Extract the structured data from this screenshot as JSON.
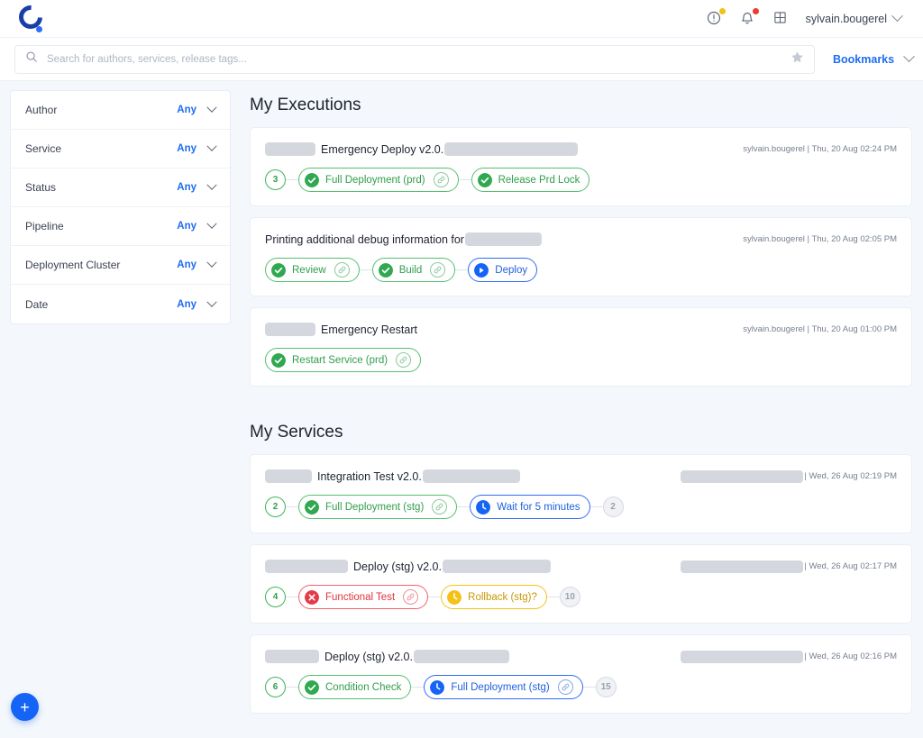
{
  "header": {
    "logo_name": "corp-logo",
    "icons": [
      {
        "name": "info-alert-icon",
        "dot": "yellow"
      },
      {
        "name": "notifications-bell-icon",
        "dot": "red"
      },
      {
        "name": "apps-grid-icon",
        "dot": "none"
      }
    ],
    "user": "sylvain.bougerel"
  },
  "search": {
    "placeholder": "Search for authors, services, release tags...",
    "value": "",
    "star_icon": "favorite-star-icon",
    "bookmarks_label": "Bookmarks"
  },
  "sidebar": {
    "filters": [
      {
        "name": "Author",
        "value": "Any"
      },
      {
        "name": "Service",
        "value": "Any"
      },
      {
        "name": "Status",
        "value": "Any"
      },
      {
        "name": "Pipeline",
        "value": "Any"
      },
      {
        "name": "Deployment Cluster",
        "value": "Any"
      },
      {
        "name": "Date",
        "value": "Any"
      }
    ]
  },
  "sections": [
    {
      "id": "executions",
      "title": "My Executions",
      "cards": [
        {
          "redact_before": 56,
          "title": "Emergency Deploy v2.0.",
          "redact_after": 148,
          "meta_redact": 0,
          "meta": "sylvain.bougerel | Thu, 20 Aug 02:24 PM",
          "lead_badge": {
            "text": "3",
            "style": "green"
          },
          "steps": [
            {
              "label": "Full Deployment (prd)",
              "style": "green",
              "icon": "check-circle-icon",
              "link": true
            },
            {
              "label": "Release Prd Lock",
              "style": "green",
              "icon": "check-circle-icon",
              "link": false
            }
          ],
          "trail_badge": null
        },
        {
          "redact_before": 0,
          "title": "Printing additional debug information for",
          "redact_after": 85,
          "meta_redact": 0,
          "meta": "sylvain.bougerel | Thu, 20 Aug 02:05 PM",
          "lead_badge": null,
          "steps": [
            {
              "label": "Review",
              "style": "green",
              "icon": "check-circle-icon",
              "link": true
            },
            {
              "label": "Build",
              "style": "green",
              "icon": "check-circle-icon",
              "link": true
            },
            {
              "label": "Deploy",
              "style": "blue",
              "icon": "play-circle-icon",
              "link": false
            }
          ],
          "trail_badge": null
        },
        {
          "redact_before": 56,
          "title": "Emergency Restart",
          "redact_after": 0,
          "meta_redact": 0,
          "meta": "sylvain.bougerel | Thu, 20 Aug 01:00 PM",
          "lead_badge": null,
          "steps": [
            {
              "label": "Restart Service (prd)",
              "style": "green",
              "icon": "check-circle-icon",
              "link": true
            }
          ],
          "trail_badge": null
        }
      ]
    },
    {
      "id": "services",
      "title": "My Services",
      "cards": [
        {
          "redact_before": 52,
          "title": "Integration Test v2.0.",
          "redact_after": 108,
          "meta_redact": 136,
          "meta": "| Wed, 26 Aug 02:19 PM",
          "lead_badge": {
            "text": "2",
            "style": "green"
          },
          "steps": [
            {
              "label": "Full Deployment (stg)",
              "style": "green",
              "icon": "check-circle-icon",
              "link": true
            },
            {
              "label": "Wait for 5 minutes",
              "style": "blue",
              "icon": "clock-circle-icon",
              "link": false
            }
          ],
          "trail_badge": {
            "text": "2",
            "style": "grey"
          }
        },
        {
          "redact_before": 92,
          "title": "Deploy (stg) v2.0.",
          "redact_after": 120,
          "meta_redact": 136,
          "meta": "| Wed, 26 Aug 02:17 PM",
          "lead_badge": {
            "text": "4",
            "style": "green"
          },
          "steps": [
            {
              "label": "Functional Test",
              "style": "red",
              "icon": "x-circle-icon",
              "link": true
            },
            {
              "label": "Rollback (stg)?",
              "style": "amber",
              "icon": "clock-circle-icon",
              "link": false
            }
          ],
          "trail_badge": {
            "text": "10",
            "style": "grey"
          }
        },
        {
          "redact_before": 60,
          "title": "Deploy (stg) v2.0.",
          "redact_after": 106,
          "meta_redact": 136,
          "meta": "| Wed, 26 Aug 02:16 PM",
          "lead_badge": {
            "text": "6",
            "style": "green"
          },
          "steps": [
            {
              "label": "Condition Check",
              "style": "green",
              "icon": "check-circle-icon",
              "link": false
            },
            {
              "label": "Full Deployment (stg)",
              "style": "blue",
              "icon": "clock-circle-icon",
              "link": true
            }
          ],
          "trail_badge": {
            "text": "15",
            "style": "grey"
          }
        }
      ]
    }
  ],
  "fab": {
    "name": "create-new-button",
    "label": "+"
  },
  "colors": {
    "accent_blue": "#1f6df0",
    "green": "#2f9e4b",
    "red": "#e0323f",
    "amber": "#c99806",
    "grey": "#9aa2ae",
    "page_bg": "#f4f7fb"
  }
}
